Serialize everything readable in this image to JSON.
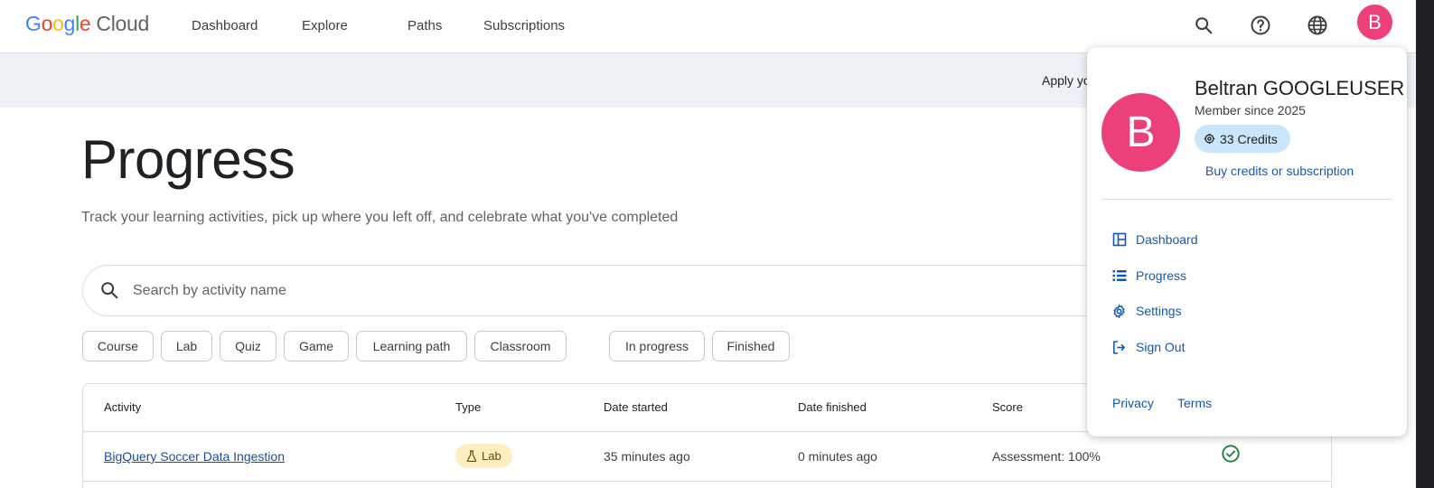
{
  "nav": {
    "logo": {
      "g1": "G",
      "g2": "o",
      "g3": "o",
      "g4": "g",
      "g5": "l",
      "g6": "e",
      "cloud": "Cloud"
    },
    "links": [
      "Dashboard",
      "Explore",
      "Paths",
      "Subscriptions"
    ],
    "icons": [
      "search-icon",
      "help-icon",
      "globe-icon"
    ],
    "avatar_initial": "B"
  },
  "banner": {
    "text": "Apply yo"
  },
  "main": {
    "title": "Progress",
    "subtitle": "Track your learning activities, pick up where you left off, and celebrate what you've completed",
    "search_placeholder": "Search by activity name",
    "type_filters": [
      "Course",
      "Lab",
      "Quiz",
      "Game",
      "Learning path",
      "Classroom"
    ],
    "status_filters": [
      "In progress",
      "Finished"
    ]
  },
  "table": {
    "headers": [
      "Activity",
      "Type",
      "Date started",
      "Date finished",
      "Score"
    ],
    "rows": [
      {
        "activity": "BigQuery Soccer Data Ingestion",
        "type": "Lab",
        "date_started": "35 minutes ago",
        "date_finished": "0 minutes ago",
        "score": "Assessment: 100%",
        "status_icon": "check-circle-icon"
      }
    ]
  },
  "profile_menu": {
    "avatar_initial": "B",
    "name": "Beltran GOOGLEUSER",
    "member_since": "Member since 2025",
    "credits": "33 Credits",
    "buy_link": "Buy credits or subscription",
    "items": [
      {
        "label": "Dashboard",
        "icon": "dashboard-icon"
      },
      {
        "label": "Progress",
        "icon": "list-icon"
      },
      {
        "label": "Settings",
        "icon": "gear-icon"
      },
      {
        "label": "Sign Out",
        "icon": "sign-out-icon"
      }
    ],
    "footer": [
      "Privacy",
      "Terms"
    ]
  },
  "colors": {
    "avatar": "#ec407a",
    "link": "#1558b0",
    "credits_bg": "#c9e6fc",
    "lab_badge_bg": "#feefc3",
    "success": "#188038"
  }
}
